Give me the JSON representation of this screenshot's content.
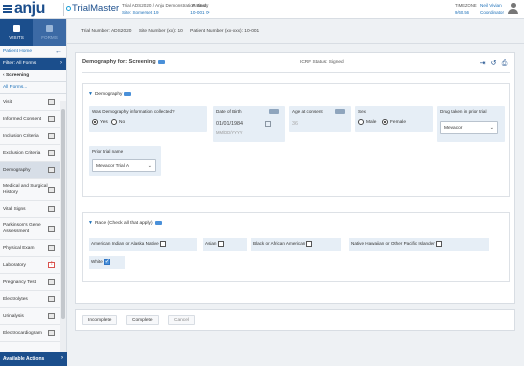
{
  "header": {
    "brand_logo": "anju",
    "product_logo": "TrialMaster",
    "study_line": "Trial ADS2020 / Anju Demonstration Study",
    "site_line": "Site: Somerset 19",
    "patient_label": "Patient:",
    "patient_id": "10-001",
    "timezone_label": "TIMEZONE",
    "timezone_value": "9/60.56",
    "user_name": "Neil Vivian",
    "user_role": "Coordinator",
    "menu_icon": "hamburger-menu-icon",
    "user_icon": "user-icon"
  },
  "sidebar": {
    "tabs": [
      {
        "label": "VISITS"
      },
      {
        "label": "FORMS"
      }
    ],
    "patient_home": "Patient Home",
    "filter": "Filter: All Forms",
    "sub_title": "Screening",
    "all_forms": "All Forms...",
    "items": [
      {
        "label": "Visit"
      },
      {
        "label": "Informed Consent"
      },
      {
        "label": "Inclusion Criteria"
      },
      {
        "label": "Exclusion Criteria"
      },
      {
        "label": "Demography"
      },
      {
        "label": "Medical and Surgical History"
      },
      {
        "label": "Vital Signs"
      },
      {
        "label": "Parkinson's Gene Assessment"
      },
      {
        "label": "Physical Exam"
      },
      {
        "label": "Laboratory"
      },
      {
        "label": "Pregnancy Test"
      },
      {
        "label": "Electrolytes"
      },
      {
        "label": "Urinalysis"
      },
      {
        "label": "Electrocardiogram"
      }
    ],
    "available_actions": "Available Actions"
  },
  "trial_bar": {
    "trial_number": "Trial Number: ADS2020",
    "site_number": "Site Number (xx): 10",
    "patient_number": "Patient Number (xx-xxx): 10-001"
  },
  "form": {
    "title": "Demography for: Screening",
    "icrf_status": "ICRF Status: Signed",
    "sections": {
      "demography": {
        "title": "Demography",
        "q_info_collected": "Was Demography information collected?",
        "yes": "Yes",
        "no": "No",
        "dob_label": "Date of Birth",
        "dob_value": "01/01/1984",
        "dob_format": "MM/DD/YYYY",
        "age_label": "Age at consent",
        "age_value": "36",
        "sex_label": "Sex",
        "male": "Male",
        "female": "Female",
        "drug_label": "Drug taken in prior trial",
        "drug_value": "Mevacor",
        "prior_trial_label": "Prior trial name",
        "prior_trial_value": "Mevacor Trial A"
      },
      "race": {
        "title": "Race (Check all that apply)",
        "options": [
          {
            "label": "American Indian or Alaska Native",
            "checked": false
          },
          {
            "label": "Asian",
            "checked": false
          },
          {
            "label": "Black or African American",
            "checked": false
          },
          {
            "label": "Native Hawaiian or Other Pacific Islander",
            "checked": false
          },
          {
            "label": "White",
            "checked": true
          }
        ]
      }
    },
    "buttons": {
      "incomplete": "Incomplete",
      "complete": "Complete",
      "cancel": "Cancel"
    }
  },
  "colors": {
    "primary": "#1b4e8c",
    "link": "#1b6fb8",
    "field_bg": "#e6eef6",
    "page_bg": "#eef1f4"
  }
}
